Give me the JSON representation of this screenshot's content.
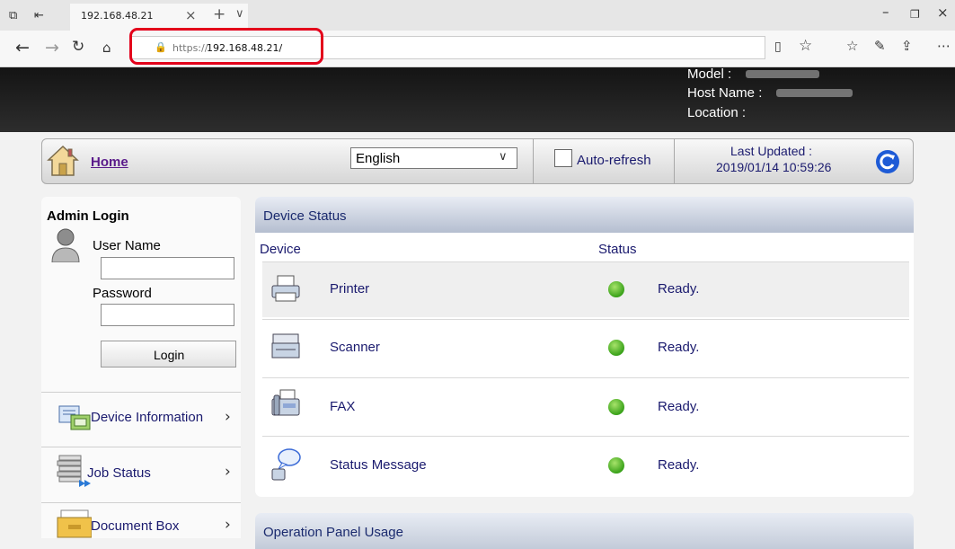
{
  "browser": {
    "tab_title": "192.168.48.21",
    "url_scheme": "https://",
    "url_host": "192.168.48.21/"
  },
  "device": {
    "model_label": "Model :",
    "host_name_label": "Host Name :",
    "location_label": "Location :"
  },
  "nav": {
    "home_label": "Home",
    "language_selected": "English",
    "auto_refresh_label": "Auto-refresh",
    "last_updated_label": "Last Updated :",
    "last_updated_value": "2019/01/14 10:59:26"
  },
  "login": {
    "title": "Admin Login",
    "username_label": "User Name",
    "username_value": "",
    "password_label": "Password",
    "password_value": "",
    "login_button": "Login"
  },
  "sidebar": {
    "items": [
      {
        "label": "Device Information"
      },
      {
        "label": "Job Status"
      },
      {
        "label": "Document Box"
      }
    ]
  },
  "device_status": {
    "title": "Device Status",
    "col_device": "Device",
    "col_status": "Status",
    "rows": [
      {
        "device": "Printer",
        "status": "Ready.",
        "icon": "printer-icon"
      },
      {
        "device": "Scanner",
        "status": "Ready.",
        "icon": "scanner-icon"
      },
      {
        "device": "FAX",
        "status": "Ready.",
        "icon": "fax-icon"
      },
      {
        "device": "Status Message",
        "status": "Ready.",
        "icon": "status-message-icon"
      }
    ]
  },
  "operation_panel": {
    "title": "Operation Panel Usage"
  },
  "colors": {
    "highlight": "#e3001b",
    "status_ready": "#3aa21a",
    "link": "#1a1a6e",
    "home_link": "#5a1a8a"
  }
}
